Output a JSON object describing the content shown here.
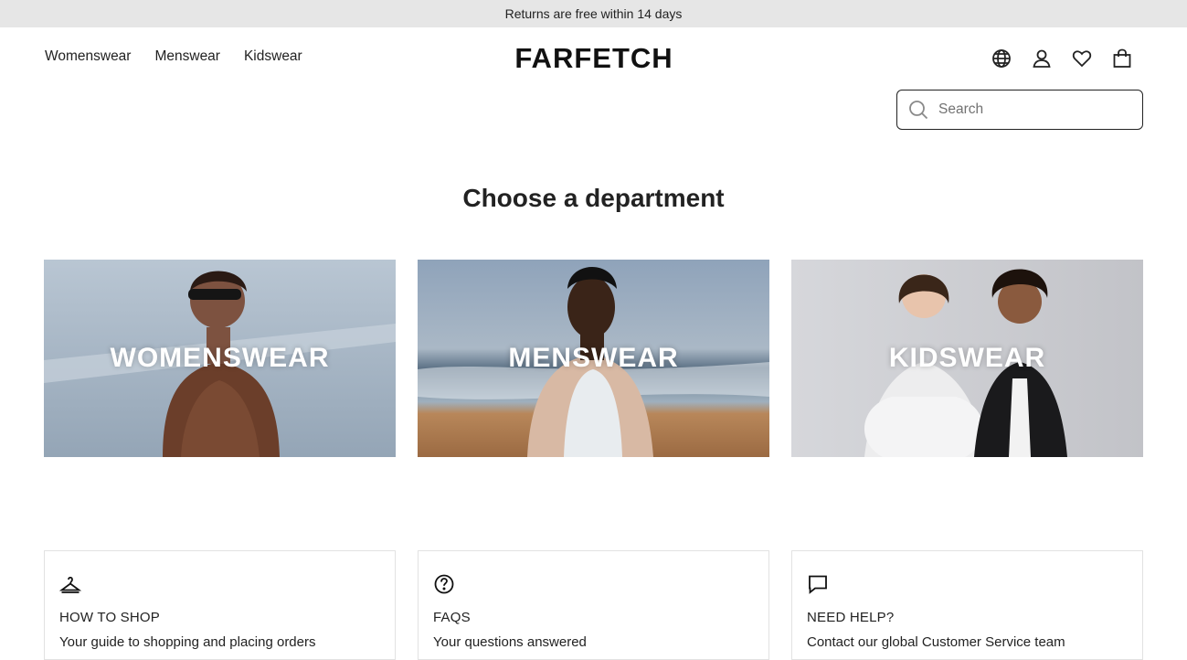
{
  "announcement": "Returns are free within 14 days",
  "nav": {
    "items": [
      "Womenswear",
      "Menswear",
      "Kidswear"
    ]
  },
  "logo": "FARFETCH",
  "header_icons": [
    "globe-icon",
    "account-icon",
    "wishlist-heart-icon",
    "shopping-bag-icon"
  ],
  "search": {
    "placeholder": "Search"
  },
  "main": {
    "heading": "Choose a department",
    "departments": [
      {
        "label": "WOMENSWEAR"
      },
      {
        "label": "MENSWEAR"
      },
      {
        "label": "KIDSWEAR"
      }
    ]
  },
  "help_cards": [
    {
      "icon": "hanger-icon",
      "title": "HOW TO SHOP",
      "description": "Your guide to shopping and placing orders"
    },
    {
      "icon": "question-circle-icon",
      "title": "FAQS",
      "description": "Your questions answered"
    },
    {
      "icon": "chat-bubble-icon",
      "title": "NEED HELP?",
      "description": "Contact our global Customer Service team"
    }
  ],
  "colors": {
    "announcement_bg": "#e6e6e6",
    "text": "#222222",
    "card_border": "#e2e2e2"
  }
}
